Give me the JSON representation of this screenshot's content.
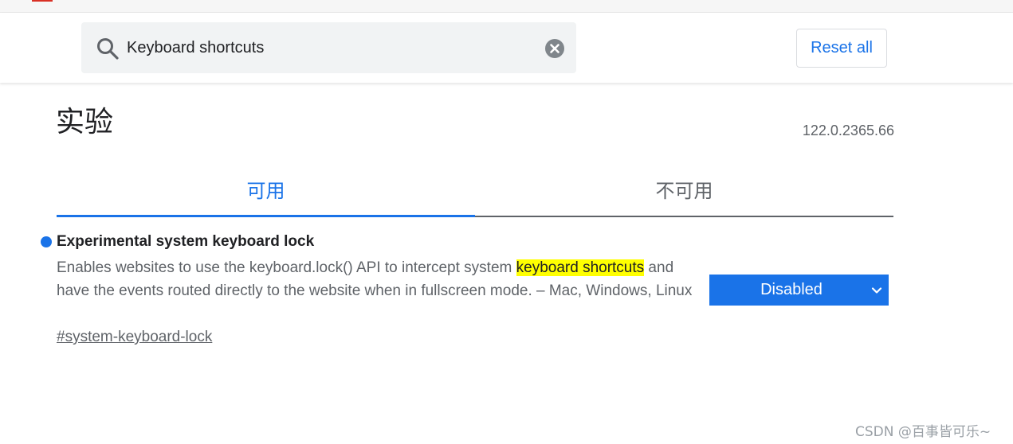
{
  "search": {
    "value": "Keyboard shortcuts",
    "search_icon": "search-icon",
    "clear_icon": "clear-icon"
  },
  "header": {
    "reset_label": "Reset all"
  },
  "page": {
    "title": "实验",
    "version": "122.0.2365.66"
  },
  "tabs": [
    {
      "label": "可用",
      "active": true
    },
    {
      "label": "不可用",
      "active": false
    }
  ],
  "experiment": {
    "title": "Experimental system keyboard lock",
    "description_before": "Enables websites to use the keyboard.lock() API to intercept system ",
    "description_highlight": "keyboard shortcuts",
    "description_after": " and have the events routed directly to the website when in fullscreen mode. – Mac, Windows, Linux",
    "link": "#system-keyboard-lock",
    "state": "Disabled"
  },
  "watermark": "CSDN @百事皆可乐~",
  "colors": {
    "accent": "#1a73e8",
    "highlight": "#ffff00",
    "select_bg": "#1a73e8"
  }
}
